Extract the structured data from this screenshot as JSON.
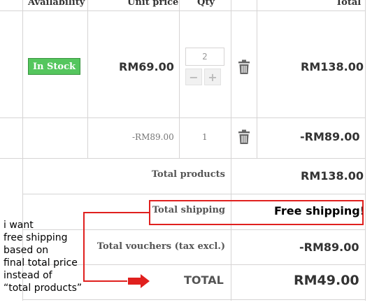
{
  "header": {
    "availability": "Availability",
    "unit_price": "Unit price",
    "qty": "Qty",
    "total": "Total"
  },
  "product_row": {
    "availability": "In Stock",
    "unit_price": "RM69.00",
    "qty": "2",
    "decrement": "−",
    "increment": "+",
    "total": "RM138.00"
  },
  "voucher_row": {
    "unit_price": "-RM89.00",
    "qty": "1",
    "total": "-RM89.00"
  },
  "summary": {
    "total_products_label": "Total products",
    "total_products_value": "RM138.00",
    "total_shipping_label": "Total shipping",
    "total_shipping_value": "Free shipping!",
    "total_vouchers_label": "Total vouchers (tax excl.)",
    "total_vouchers_value": "-RM89.00",
    "total_label": "TOTAL",
    "total_value": "RM49.00"
  },
  "annotation": {
    "note": "i want\nfree shipping\nbased on\nfinal total price\ninstead of\n“total products”"
  },
  "icons": [
    "trash-icon",
    "arrow-right-icon"
  ],
  "colors": {
    "in_stock_bg": "#55c65e",
    "annotation_red": "#e0201e",
    "border": "#d6d4d4"
  }
}
